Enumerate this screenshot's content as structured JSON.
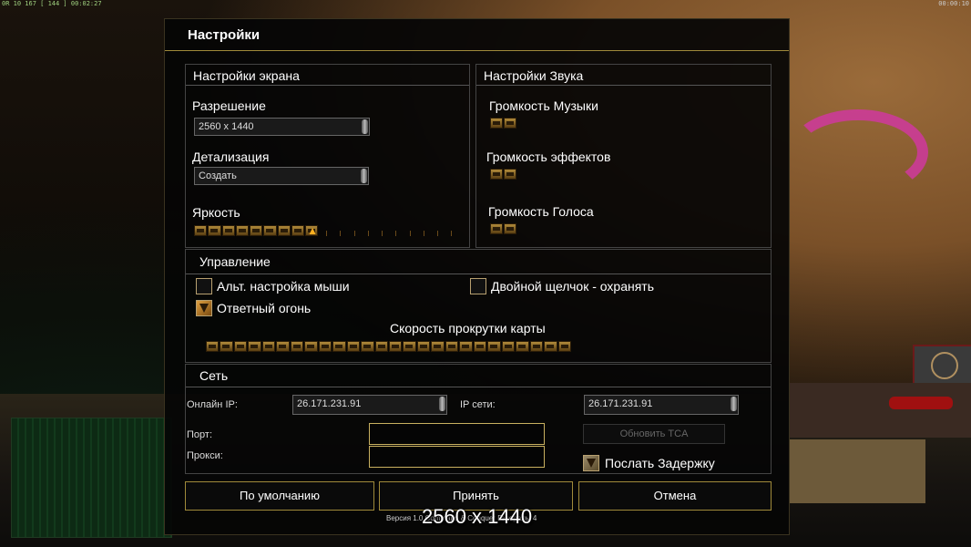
{
  "hud": {
    "top_left": "0R 10 167 [ 144 ] 00:02:27",
    "top_right": "00:00:10"
  },
  "dialog": {
    "title": "Настройки",
    "screen": {
      "header": "Настройки экрана",
      "resolution_label": "Разрешение",
      "resolution_value": "2560 x 1440",
      "detail_label": "Детализация",
      "detail_value": "Создать",
      "brightness_label": "Яркость",
      "brightness_level": 0.48
    },
    "sound": {
      "header": "Настройки Звука",
      "music_label": "Громкость Музыки",
      "effects_label": "Громкость эффектов",
      "voice_label": "Громкость Голоса"
    },
    "control": {
      "header": "Управление",
      "alt_mouse_label": "Альт. настройка мыши",
      "alt_mouse_checked": false,
      "double_click_label": "Двойной щелчок - охранять",
      "double_click_checked": false,
      "return_fire_label": "Ответный огонь",
      "return_fire_checked": true,
      "scroll_label": "Скорость прокрутки карты",
      "scroll_level": 1.0
    },
    "network": {
      "header": "Сеть",
      "online_ip_label": "Онлайн IP:",
      "online_ip_value": "26.171.231.91",
      "lan_ip_label": "IP сети:",
      "lan_ip_value": "26.171.231.91",
      "port_label": "Порт:",
      "proxy_label": "Прокси:",
      "update_button": "Обновить TCA",
      "send_delay_label": "Послать Задержку",
      "send_delay_checked": true
    },
    "buttons": {
      "defaults": "По умолчанию",
      "accept": "Принять",
      "cancel": "Отмена"
    },
    "version": "Версия 1.0 Command & Conquer Генералы 4"
  },
  "overlay_resolution": "2560 x 1440",
  "colors": {
    "accent_gold": "#a08a3a",
    "slider_bronze": "#b08a3a",
    "background": "#000000"
  }
}
